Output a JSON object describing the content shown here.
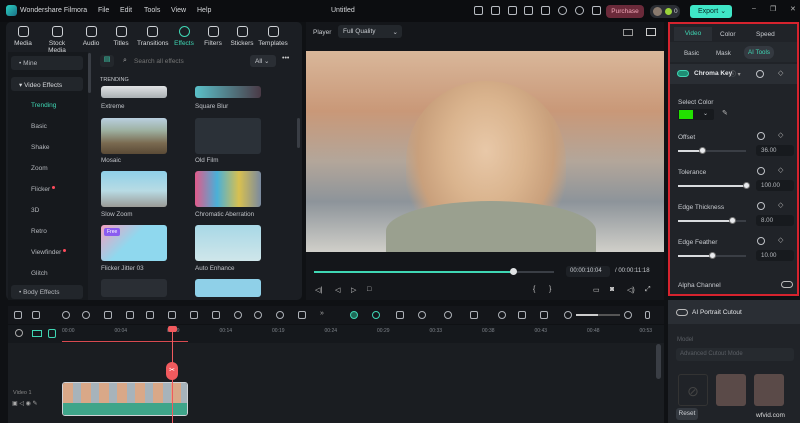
{
  "app": {
    "name": "Wondershare Filmora",
    "doc_title": "Untitled",
    "menu": [
      "File",
      "Edit",
      "Tools",
      "View",
      "Help"
    ],
    "purchase": "Purchase",
    "credits": "0",
    "export": "Export"
  },
  "library": {
    "tabs": [
      "Media",
      "Stock Media",
      "Audio",
      "Titles",
      "Transitions",
      "Effects",
      "Filters",
      "Stickers",
      "Templates"
    ],
    "active_tab": "Effects",
    "sidebar": {
      "groups": [
        "Mine",
        "Video Effects",
        "Body Effects"
      ],
      "items": [
        {
          "label": "Trending",
          "active": true
        },
        {
          "label": "Basic"
        },
        {
          "label": "Shake"
        },
        {
          "label": "Zoom"
        },
        {
          "label": "Flicker",
          "dot": true
        },
        {
          "label": "3D"
        },
        {
          "label": "Retro"
        },
        {
          "label": "Viewfinder",
          "dot": true
        },
        {
          "label": "Glitch"
        }
      ]
    },
    "search_placeholder": "Search all effects",
    "filter": "All",
    "section": "TRENDING",
    "effects": [
      "Extreme",
      "Square Blur",
      "Mosaic",
      "Old Film",
      "Slow Zoom",
      "Chromatic Aberration",
      "Flicker Jitter 03",
      "Auto Enhance"
    ],
    "badge_free": "Free"
  },
  "player": {
    "label": "Player",
    "quality": "Full Quality",
    "current_time": "00:00:10:04",
    "total_time": "/ 00:00:11:18",
    "progress": 0.83
  },
  "properties": {
    "tabs": [
      "Video",
      "Color",
      "Speed"
    ],
    "active_tab": "Video",
    "subtabs": [
      "Basic",
      "Mask",
      "AI Tools"
    ],
    "active_subtab": "AI Tools",
    "chroma_key": {
      "label": "Chroma Key",
      "enabled": true
    },
    "select_color_label": "Select Color",
    "key_color": "#22e000",
    "params": [
      {
        "label": "Offset",
        "value": "36.00",
        "fraction": 0.36
      },
      {
        "label": "Tolerance",
        "value": "100.00",
        "fraction": 1.0
      },
      {
        "label": "Edge Thickness",
        "value": "8.00",
        "fraction": 0.8
      },
      {
        "label": "Edge Feather",
        "value": "10.00",
        "fraction": 0.5
      }
    ],
    "alpha_channel": "Alpha Channel",
    "ai_portrait": "AI Portrait Cutout",
    "model_label": "Model",
    "model_value": "Advanced Cutout Mode",
    "reset": "Reset"
  },
  "timeline": {
    "ruler": [
      "00:00",
      "00:04",
      "00:09",
      "00:14",
      "00:19",
      "00:24",
      "00:29",
      "00:33",
      "00:38",
      "00:43",
      "00:48",
      "00:53"
    ],
    "track_label": "Video 1"
  },
  "watermark": "wfvid.com"
}
